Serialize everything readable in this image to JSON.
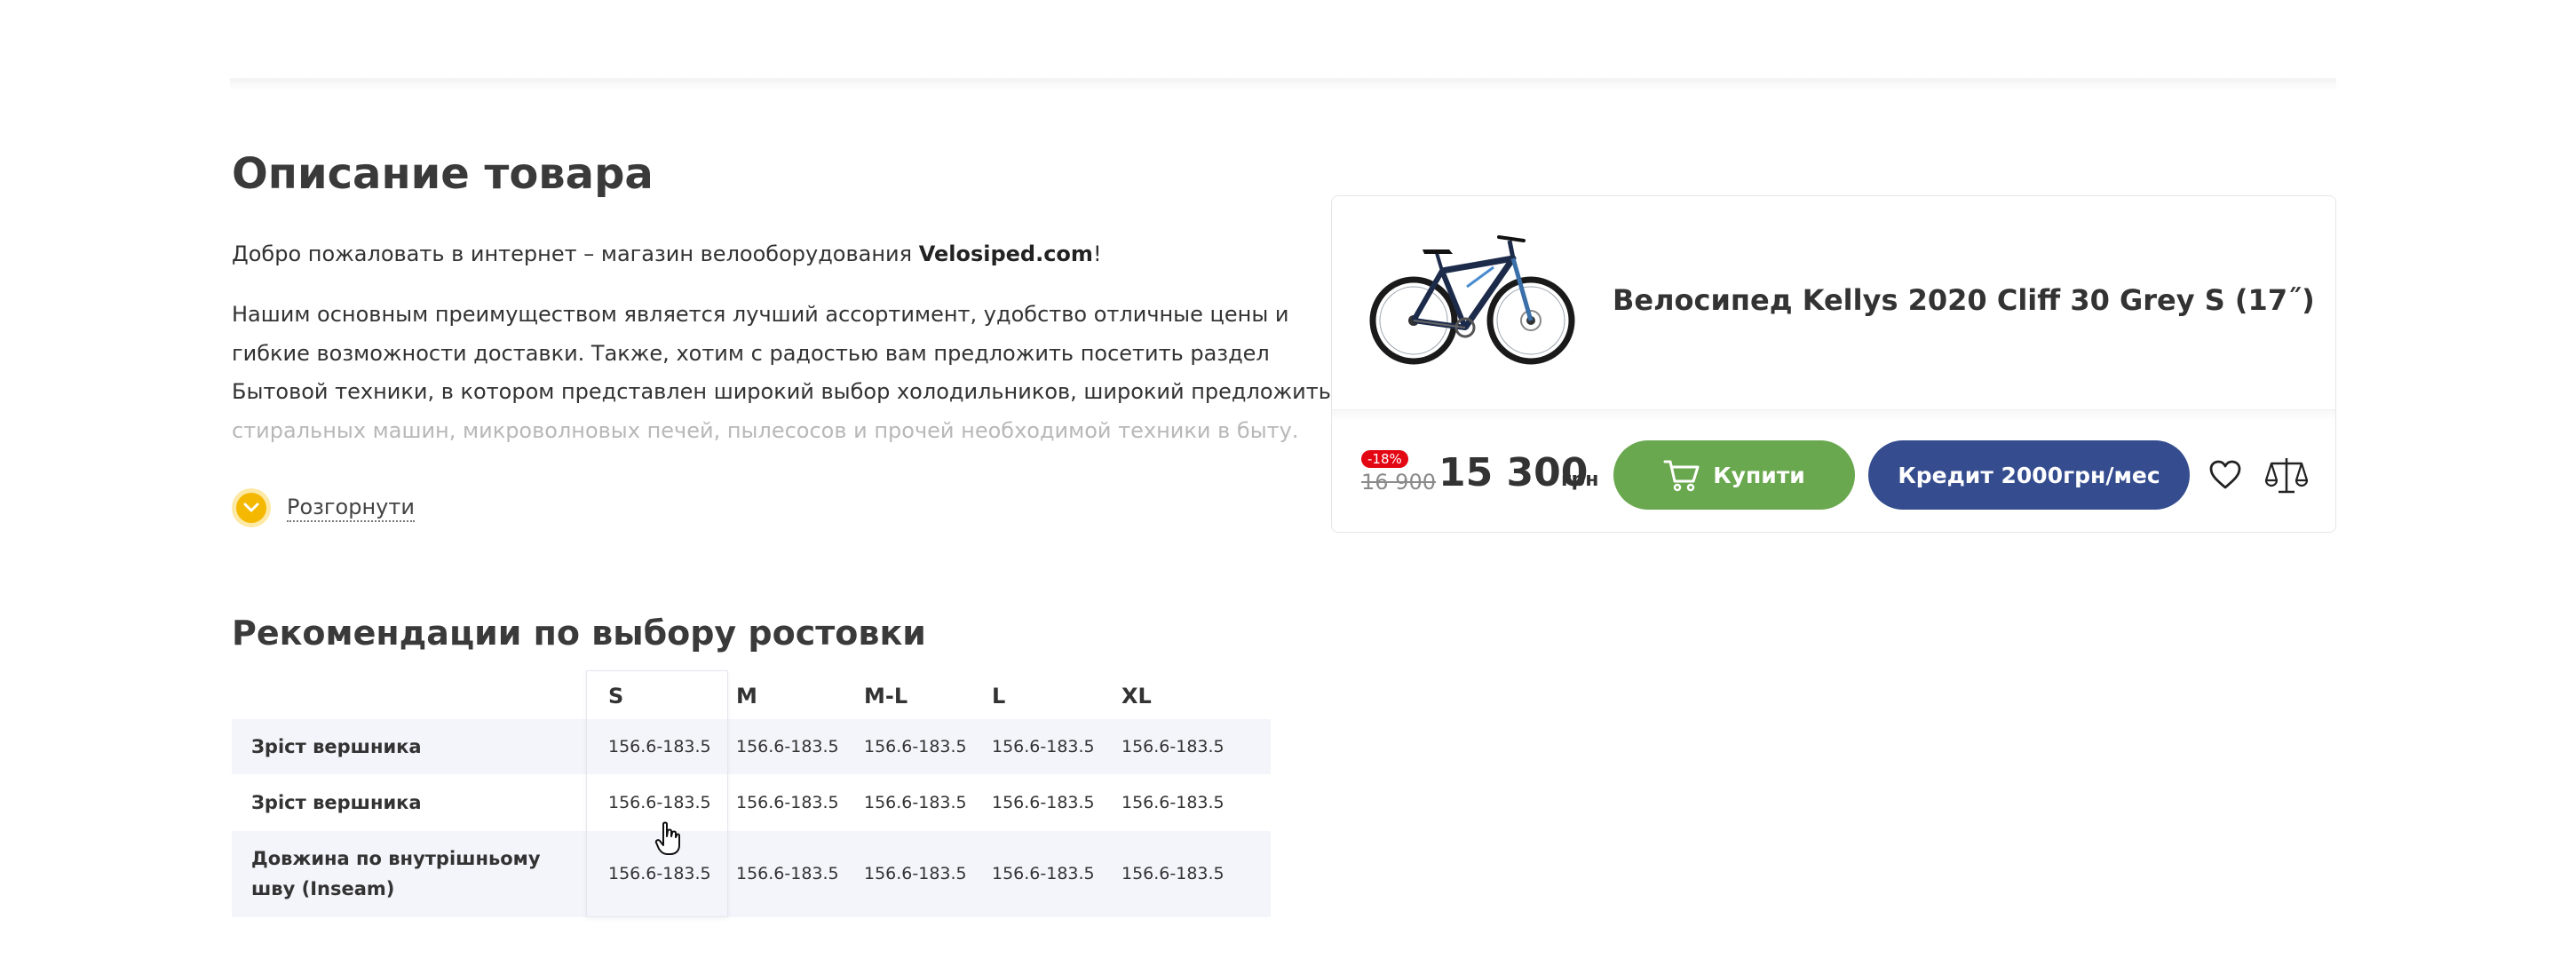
{
  "description": {
    "title": "Описание товара",
    "intro_prefix": "Добро пожаловать в интернет – магазин велооборудования ",
    "intro_brand": "Velosiped.com",
    "intro_suffix": "!",
    "body_lines": [
      "Нашим основным преимуществом является лучший ассортимент, удобство отличные цены и",
      "гибкие возможности доставки. Также, хотим с радостью вам предложить посетить раздел",
      "Бытовой техники, в котором представлен широкий выбор холодильников, широкий предложить",
      "стиральных машин, микроволновых печей, пылесосов и прочей необходимой техники в быту."
    ],
    "expand_label": "Розгорнути"
  },
  "size_guide": {
    "title": "Рекомендации по выбору ростовки",
    "columns": [
      "S",
      "M",
      "M-L",
      "L",
      "XL"
    ],
    "rows": [
      {
        "label_lines": [
          "Зріст вершника"
        ],
        "values": [
          "156.6-183.5",
          "156.6-183.5",
          "156.6-183.5",
          "156.6-183.5",
          "156.6-183.5"
        ]
      },
      {
        "label_lines": [
          "Зріст вершника"
        ],
        "values": [
          "156.6-183.5",
          "156.6-183.5",
          "156.6-183.5",
          "156.6-183.5",
          "156.6-183.5"
        ]
      },
      {
        "label_lines": [
          "Довжина по внутрішньому",
          "шву (Inseam)"
        ],
        "values": [
          "156.6-183.5",
          "156.6-183.5",
          "156.6-183.5",
          "156.6-183.5",
          "156.6-183.5"
        ]
      }
    ]
  },
  "product": {
    "name": "Велосипед Kellys 2020 Cliff 30 Grey S (17˝)",
    "discount": "-18%",
    "old_price": "16 900",
    "price": "15 300",
    "currency": "грн",
    "buy_label": "Купити",
    "credit_label": "Кредит 2000грн/мес"
  },
  "colors": {
    "buy_green": "#6aa84f",
    "credit_blue": "#354d8f",
    "discount_red": "#e30613",
    "accent_yellow": "#f5b800"
  },
  "icons": {
    "expand": "chevron-down-icon",
    "cart": "cart-icon",
    "favorite": "heart-icon",
    "compare": "scales-icon"
  }
}
